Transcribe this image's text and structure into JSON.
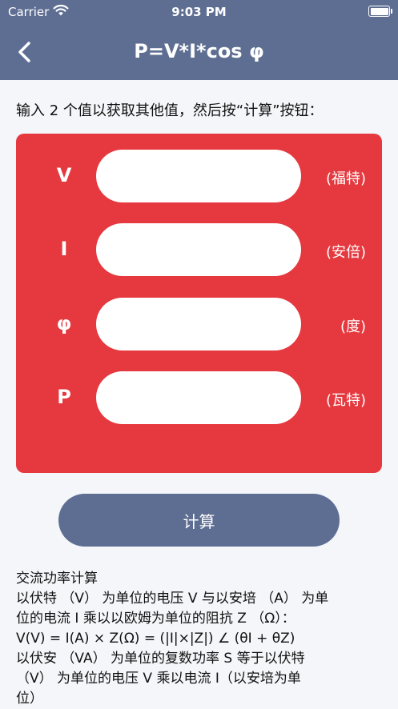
{
  "status_bar": {
    "carrier": "Carrier",
    "time": "9:03 PM"
  },
  "nav": {
    "title": "P=V*I*cos φ"
  },
  "instruction": "输入 2 个值以获取其他值，然后按“计算”按钮：",
  "fields": [
    {
      "label": "V",
      "unit": "(福特)",
      "value": ""
    },
    {
      "label": "I",
      "unit": "(安倍)",
      "value": ""
    },
    {
      "label": "φ",
      "unit": "(度)",
      "value": ""
    },
    {
      "label": "P",
      "unit": "(瓦特)",
      "value": ""
    }
  ],
  "calculate_label": "计算",
  "description": [
    "交流功率计算",
    "以伏特 （V） 为单位的电压 V 与以安培 （A） 为单",
    "位的电流 I 乘以以欧姆为单位的阻抗 Z （Ω）：",
    "V(V) = I(A) × Z(Ω) = (|I|×|Z|) ∠ (θI + θZ)",
    "以伏安 （VA） 为单位的复数功率 S 等于以伏特",
    "（V） 为单位的电压 V 乘以电流 I（以安培为单",
    "位）"
  ],
  "colors": {
    "primary": "#5e6e92",
    "card": "#e5393f",
    "background": "#f5f6fa"
  }
}
